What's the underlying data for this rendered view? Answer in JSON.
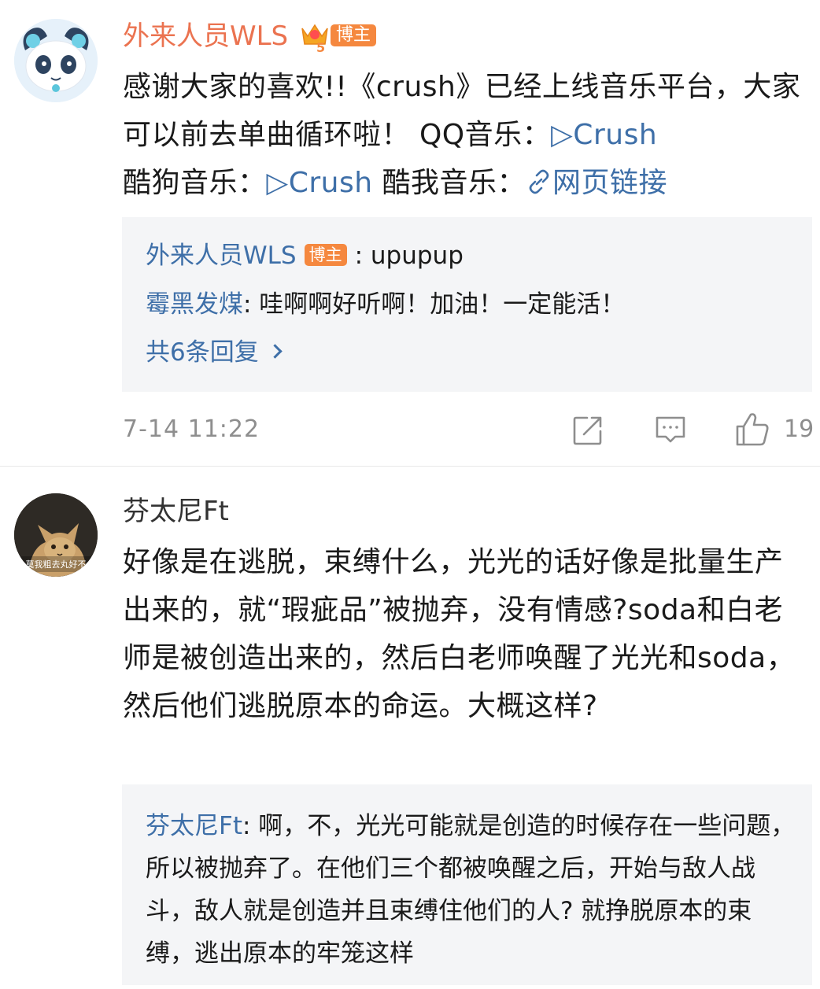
{
  "comment1": {
    "username": "外来人员WLS",
    "role_badge": "博主",
    "text_main": "感谢大家的喜欢!!《crush》已经上线音乐平台，大家可以前去单曲循环啦！ QQ音乐：",
    "link1": "▷Crush",
    "text_mid": " 酷狗音乐：",
    "link2": "▷Crush",
    "text_mid2": "  酷我音乐：",
    "link3": "网页链接",
    "replies": {
      "reply1_name": "外来人员WLS",
      "reply1_badge": "博主",
      "reply1_text": ": upupup",
      "reply2_name": "霉黑发煤",
      "reply2_text": ": 哇啊啊好听啊！加油！一定能活！",
      "more_label": "共6条回复"
    },
    "timestamp": "7-14 11:22",
    "like_count": "19"
  },
  "comment2": {
    "username": "芬太尼Ft",
    "text": "好像是在逃脱，束缚什么，光光的话好像是批量生产出来的，就“瑕疵品”被抛弃，没有情感?soda和白老师是被创造出来的，然后白老师唤醒了光光和soda，然后他们逃脱原本的命运。大概这样?",
    "reply": {
      "name": "芬太尼Ft",
      "text": ": 啊，不，光光可能就是创造的时候存在一些问题，所以被抛弃了。在他们三个都被唤醒之后，开始与敌人战斗，敌人就是创造并且束缚住他们的人? 就挣脱原本的束缚，逃出原本的牢笼这样"
    }
  },
  "icons": {
    "share": "share-icon",
    "comment": "comment-icon",
    "like": "thumbs-up-icon",
    "link": "link-icon",
    "vip": "vip-crown-icon"
  },
  "colors": {
    "username_orange": "#eb7350",
    "link_blue": "#3e6fa8",
    "badge_orange": "#f5883f",
    "reply_bg": "#f4f5f7",
    "meta_gray": "#8e8e8e"
  }
}
